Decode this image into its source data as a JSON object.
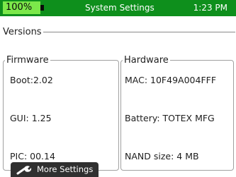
{
  "status_bar": {
    "battery_percent": "100%",
    "title": "System Settings",
    "time": "1:23 PM",
    "colors": {
      "bar": "#0e8f1c",
      "battery_fill": "#7ce84a"
    }
  },
  "versions": {
    "legend": "Versions",
    "firmware": {
      "legend": "Firmware",
      "rows": [
        "Boot:2.02",
        "GUI: 1.25",
        "PIC: 00.14"
      ]
    },
    "hardware": {
      "legend": "Hardware",
      "rows": [
        "MAC: 10F49A004FFF",
        "Battery: TOTEX MFG",
        "NAND size: 4 MB"
      ]
    }
  },
  "bottom_bar": {
    "more_settings_label": "More Settings",
    "icon": "wrench-icon"
  }
}
